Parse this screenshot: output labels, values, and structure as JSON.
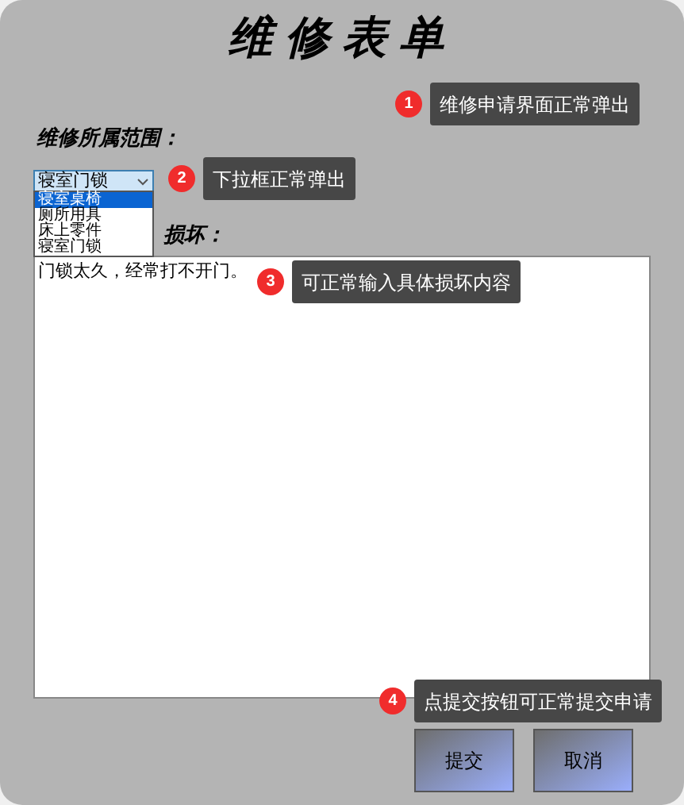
{
  "title": "维修表单",
  "scope_label": "维修所属范围：",
  "select": {
    "value": "寝室门锁",
    "options": [
      {
        "label": "寝室桌椅",
        "highlighted": true
      },
      {
        "label": "厕所用具",
        "highlighted": false
      },
      {
        "label": "床上零件",
        "highlighted": false
      },
      {
        "label": "寝室门锁",
        "highlighted": false
      }
    ]
  },
  "damage_label": "损坏：",
  "description": {
    "value": "门锁太久，经常打不开门。"
  },
  "annotations": [
    {
      "number": "1",
      "text": "维修申请界面正常弹出"
    },
    {
      "number": "2",
      "text": "下拉框正常弹出"
    },
    {
      "number": "3",
      "text": "可正常输入具体损坏内容"
    },
    {
      "number": "4",
      "text": "点提交按钮可正常提交申请"
    }
  ],
  "buttons": [
    "提交",
    "取消"
  ]
}
